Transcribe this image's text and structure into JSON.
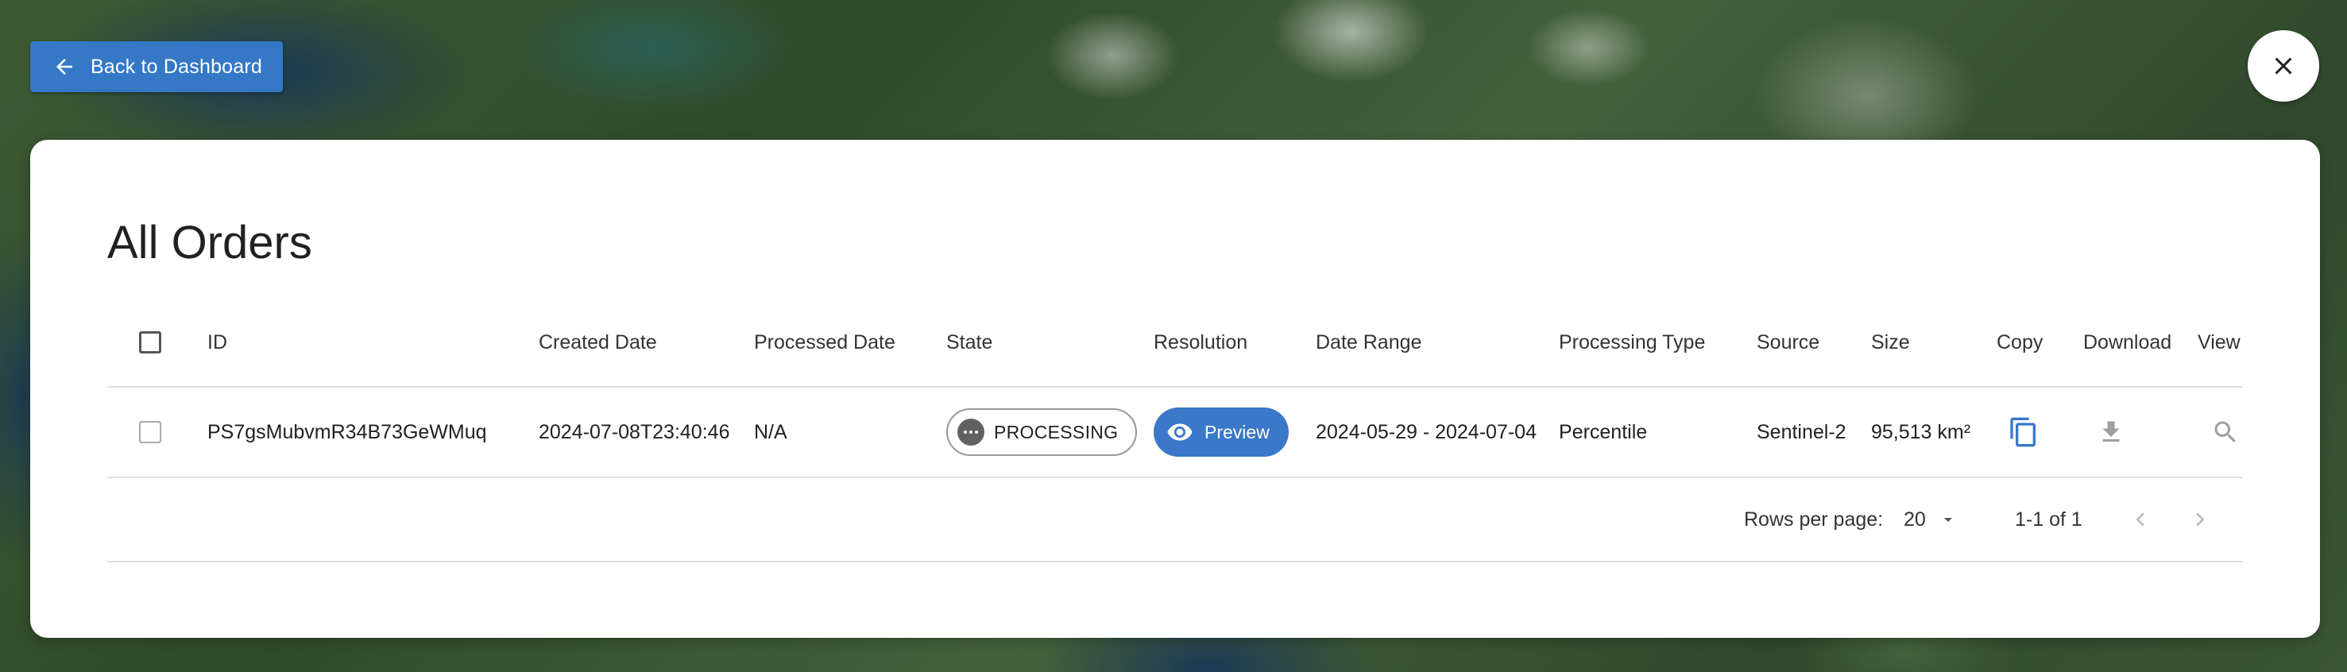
{
  "nav": {
    "back_label": "Back to Dashboard",
    "back_icon": "arrow-left-icon",
    "close_icon": "close-icon"
  },
  "page": {
    "title": "All Orders"
  },
  "colors": {
    "accent": "#3578c6",
    "chip_preview": "#3a78c9",
    "copy_icon": "#3a78c9",
    "disabled_icon": "#9e9e9e"
  },
  "table": {
    "columns": {
      "id": "ID",
      "created": "Created Date",
      "processed": "Processed Date",
      "state": "State",
      "resolution": "Resolution",
      "date_range": "Date Range",
      "processing_type": "Processing Type",
      "source": "Source",
      "size": "Size",
      "copy": "Copy",
      "download": "Download",
      "view": "View"
    },
    "rows": [
      {
        "id": "PS7gsMubvmR34B73GeWMuq",
        "created": "2024-07-08T23:40:46",
        "processed": "N/A",
        "state": "PROCESSING",
        "resolution": "Preview",
        "date_range": "2024-05-29 - 2024-07-04",
        "processing_type": "Percentile",
        "source": "Sentinel-2",
        "size": "95,513 km²"
      }
    ]
  },
  "pagination": {
    "rows_per_page_label": "Rows per page:",
    "rows_per_page_value": "20",
    "range": "1-1 of 1"
  }
}
